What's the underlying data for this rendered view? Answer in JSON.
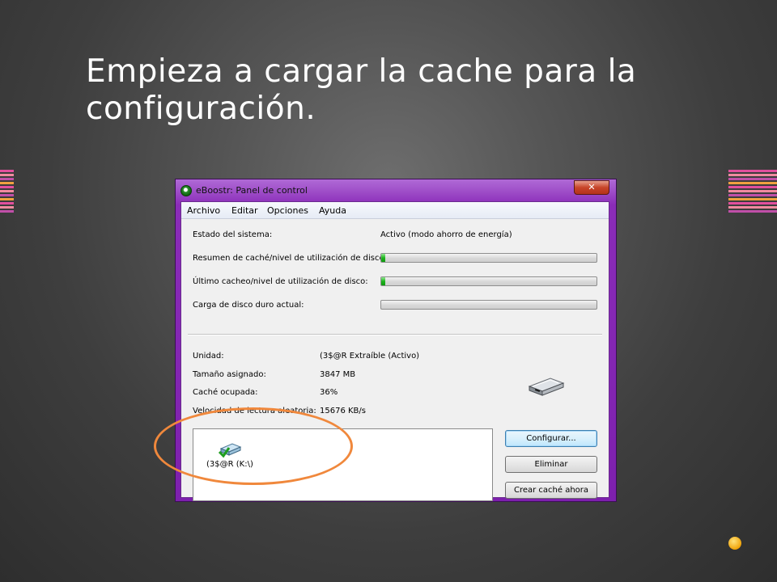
{
  "slide": {
    "title": "Empieza a cargar la cache para la configuración."
  },
  "colors": {
    "accent_orange": "#f0883c",
    "window_frame": "#8a2cb8",
    "progress_fill": "#1fb41f"
  },
  "window": {
    "title": "eBoostr: Panel de control",
    "close_label": "✕",
    "menu": [
      "Archivo",
      "Editar",
      "Opciones",
      "Ayuda"
    ],
    "status": {
      "system_state_label": "Estado del sistema:",
      "system_state_value": "Activo (modo ahorro de energía)",
      "cache_summary_label": "Resumen de caché/nivel de utilización de disco:",
      "cache_summary_level": 0.02,
      "last_cache_label": "Último cacheo/nivel de utilización de disco:",
      "last_cache_level": 0.02,
      "disk_load_label": "Carga de disco duro actual:",
      "disk_load_level": 0
    },
    "device": {
      "unit_label": "Unidad:",
      "unit_value": "(3$@R Extraíble (Activo)",
      "size_label": "Tamaño asignado:",
      "size_value": "3847 MB",
      "used_label": "Caché ocupada:",
      "used_value": "36%",
      "speed_label": "Velocidad de lectura aleatoria:",
      "speed_value": "15676 KB/s",
      "icon": "removable-drive-icon"
    },
    "drive_list": [
      {
        "label": "(3$@R (K:\\)",
        "icon": "drive-check-icon"
      }
    ],
    "buttons": {
      "configure": "Configurar...",
      "remove": "Eliminar",
      "create_cache": "Crear caché ahora"
    }
  }
}
